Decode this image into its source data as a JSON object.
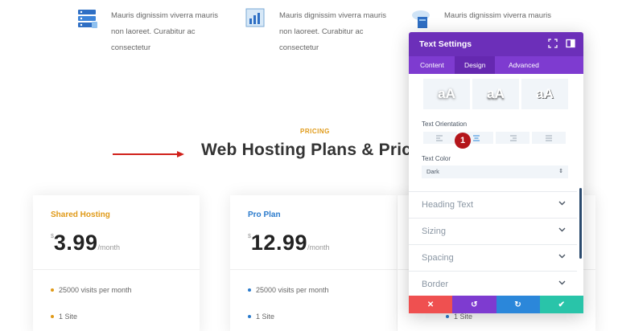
{
  "features": [
    {
      "icon": "server-icon",
      "text": "Mauris dignissim viverra mauris non laoreet. Curabitur ac consectetur"
    },
    {
      "icon": "chart-icon",
      "text": "Mauris dignissim viverra mauris non laoreet. Curabitur ac consectetur"
    },
    {
      "icon": "cloud-server-icon",
      "text": "Mauris dignissim viverra mauris"
    }
  ],
  "pricing": {
    "eyebrow": "PRICING",
    "heading": "Web Hosting Plans & Pricing"
  },
  "plans": [
    {
      "name": "Shared Hosting",
      "currency": "$",
      "amount": "3.99",
      "period": "/month",
      "items": [
        "25000 visits per month",
        "1 Site"
      ]
    },
    {
      "name": "Pro Plan",
      "currency": "$",
      "amount": "12.99",
      "period": "/month",
      "items": [
        "25000 visits per month",
        "1 Site"
      ]
    },
    {
      "name": "",
      "currency": "",
      "amount": "",
      "period": "",
      "items": [
        "",
        "1 Site"
      ]
    }
  ],
  "modal": {
    "title": "Text Settings",
    "tabs": [
      "Content",
      "Design",
      "Advanced"
    ],
    "active_tab": "Design",
    "shadow_preset_label": "aA",
    "text_orientation_label": "Text Orientation",
    "marker": "1",
    "text_color_label": "Text Color",
    "text_color_value": "Dark",
    "accordions": [
      "Heading Text",
      "Sizing",
      "Spacing",
      "Border"
    ],
    "footer": {
      "cancel": "✕",
      "undo": "↺",
      "redo": "↻",
      "save": "✔"
    }
  },
  "colors": {
    "modal_header": "#6c2fb9",
    "modal_tabs": "#7e3bd0",
    "cancel": "#ef5050",
    "undo": "#7e3bd0",
    "redo": "#2b87da",
    "save": "#29c4a9",
    "pricing_accent": "#e09a18",
    "pro_accent": "#2b7bcc",
    "annotation_arrow": "#d0201a"
  }
}
